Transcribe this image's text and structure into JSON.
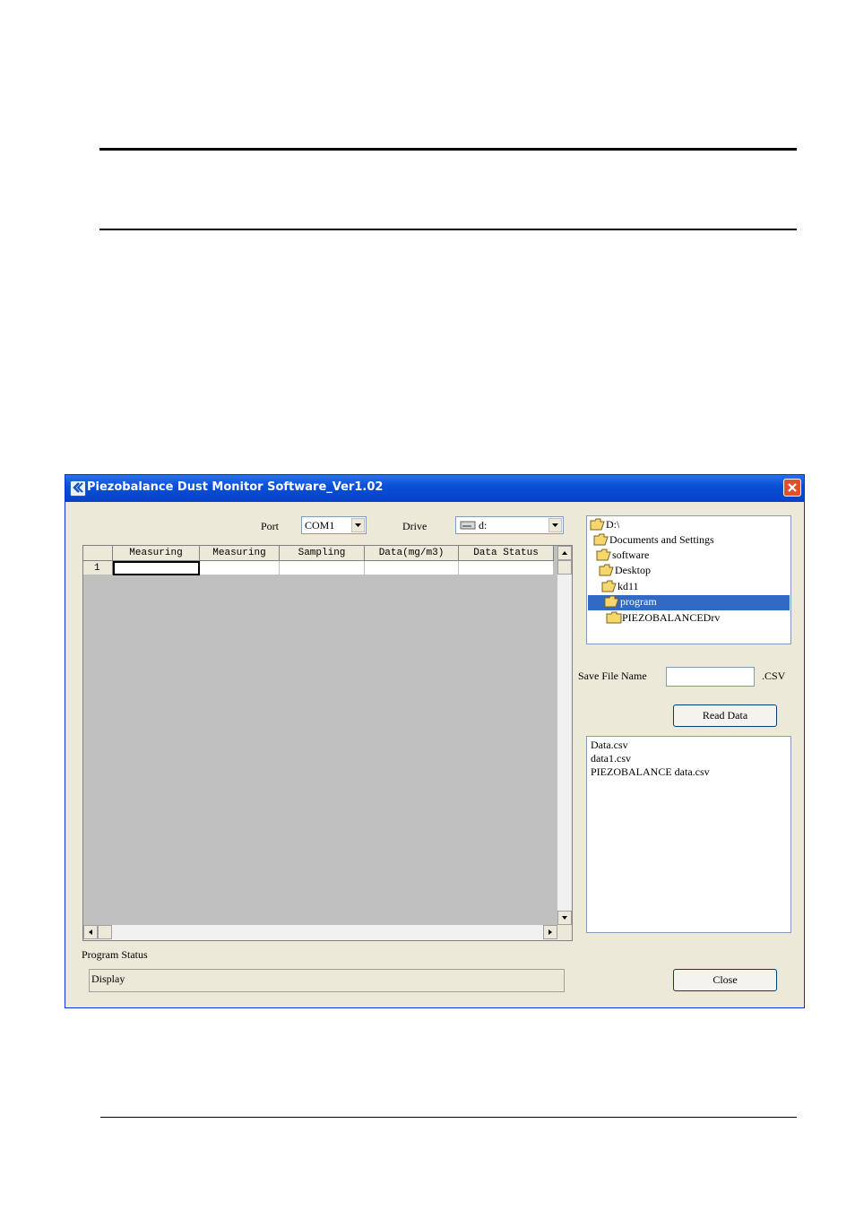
{
  "window": {
    "title": "Piezobalance Dust Monitor Software_Ver1.02"
  },
  "controls": {
    "port_label": "Port",
    "port_value": "COM1",
    "drive_label": "Drive",
    "drive_value": "d:"
  },
  "grid": {
    "columns": [
      "Measuring",
      "Measuring",
      "Sampling",
      "Data(mg/m3)",
      "Data Status"
    ],
    "rows": [
      {
        "num": "1",
        "cells": [
          "",
          "",
          "",
          "",
          ""
        ]
      }
    ]
  },
  "folder_tree": {
    "items": [
      {
        "label": "D:\\",
        "selected": false
      },
      {
        "label": "Documents and Settings",
        "selected": false
      },
      {
        "label": "software",
        "selected": false
      },
      {
        "label": "Desktop",
        "selected": false
      },
      {
        "label": "kd11",
        "selected": false
      },
      {
        "label": "program",
        "selected": true
      },
      {
        "label": "PIEZOBALANCEDrv",
        "selected": false
      }
    ]
  },
  "save": {
    "label": "Save File Name",
    "value": "",
    "extension": ".CSV"
  },
  "buttons": {
    "read_data": "Read Data",
    "close": "Close"
  },
  "file_list": {
    "items": [
      "Data.csv",
      "data1.csv",
      "PIEZOBALANCE data.csv"
    ]
  },
  "status": {
    "label": "Program Status",
    "value": "Display"
  },
  "colors": {
    "title_bar": "#0a50d8",
    "window_bg": "#ece9d8",
    "selection": "#316ac5",
    "close_button": "#e0502a"
  }
}
